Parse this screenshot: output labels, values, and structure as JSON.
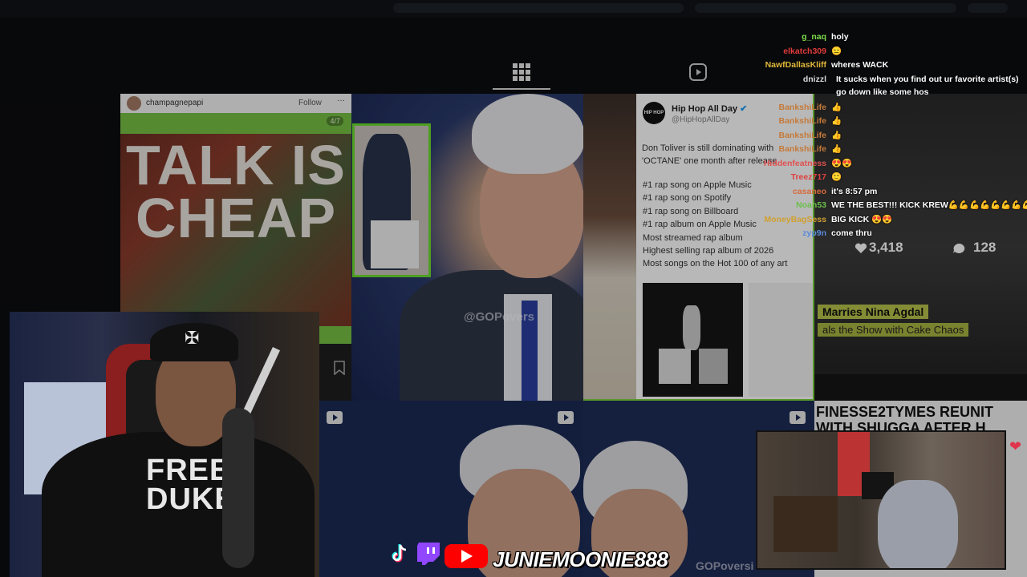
{
  "colors": {
    "accent_green": "#76c044",
    "highlight_green": "#6bdb2f",
    "youtube_red": "#ff0000",
    "twitch_purple": "#9146ff"
  },
  "tabs": {
    "grid_icon": "grid-icon",
    "reels_icon": "reels-icon"
  },
  "tile1": {
    "username": "champagnepapi",
    "follow_label": "Follow",
    "more_label": "···",
    "page_indicator": "4/7",
    "headline": "TALK IS CHEAP",
    "bookmark_icon": "bookmark-icon"
  },
  "tile2": {
    "watermark": "@GOPovers"
  },
  "tile3": {
    "account": "Hip Hop All Day",
    "handle": "@HipHopAllDay",
    "avatar_text": "HIP HOP ALL DAY",
    "lead": "Don Toliver is still dominating with 'OCTANE' one month after release",
    "list": [
      "#1 rap song on Apple Music",
      "#1 rap song on Spotify",
      "#1 rap song on Billboard",
      "#1 rap album on Apple Music",
      "Most streamed rap album",
      "Highest selling rap album of 2026",
      "Most songs on the Hot 100 of any art"
    ]
  },
  "tile4": {
    "likes": "3,418",
    "comments": "128",
    "banner1": "Marries Nina Agdal",
    "banner2": "als the Show with Cake Chaos"
  },
  "tile5": {
    "reel_icon": "reels-icon"
  },
  "tile6": {
    "watermark": "GOPoversi"
  },
  "tile7": {
    "headline": "FINESSE2TYMES REUNIT WITH SHUGGA AFTER H"
  },
  "chat": [
    {
      "user": "g_naq",
      "color": "#7ddc4a",
      "message": "holy"
    },
    {
      "user": "elkatch309",
      "color": "#e23b3b",
      "message": "😐"
    },
    {
      "user": "NawfDallasKliff",
      "color": "#e0b83a",
      "message": "wheres WACK"
    },
    {
      "user": "dnizzl",
      "color": "#d8d8d8",
      "message": "It sucks when you find out ur favorite artist(s) go down like some hos"
    },
    {
      "user": "BankshiLife",
      "color": "#c47a3a",
      "message": "👍"
    },
    {
      "user": "BankshiLife",
      "color": "#c47a3a",
      "message": "👍"
    },
    {
      "user": "BankshiLife",
      "color": "#c47a3a",
      "message": "👍"
    },
    {
      "user": "BankshiLife",
      "color": "#c47a3a",
      "message": "👍"
    },
    {
      "user": "Hiddenfeatness",
      "color": "#e05050",
      "message": "😍😍"
    },
    {
      "user": "Treez717",
      "color": "#e04040",
      "message": "🙂"
    },
    {
      "user": "casaneo",
      "color": "#d86a3a",
      "message": "it's 8:57 pm"
    },
    {
      "user": "Noah53",
      "color": "#6ac04a",
      "message": "WE THE BEST!!! KICK KREW💪💪💪💪💪💪💪💪"
    },
    {
      "user": "MoneyBagSess",
      "color": "#d0a030",
      "message": "BIG KICK 😍😍"
    },
    {
      "user": "zyp9n",
      "color": "#5a8ad8",
      "message": "come thru"
    }
  ],
  "branding": {
    "channel_name": "JUNIEMOONIE888",
    "tiktok_icon": "tiktok-icon",
    "twitch_icon": "twitch-icon",
    "youtube_icon": "youtube-icon"
  },
  "webcam1": {
    "cap_logo": "✠",
    "hoodie_text": "FREE DUKE"
  }
}
